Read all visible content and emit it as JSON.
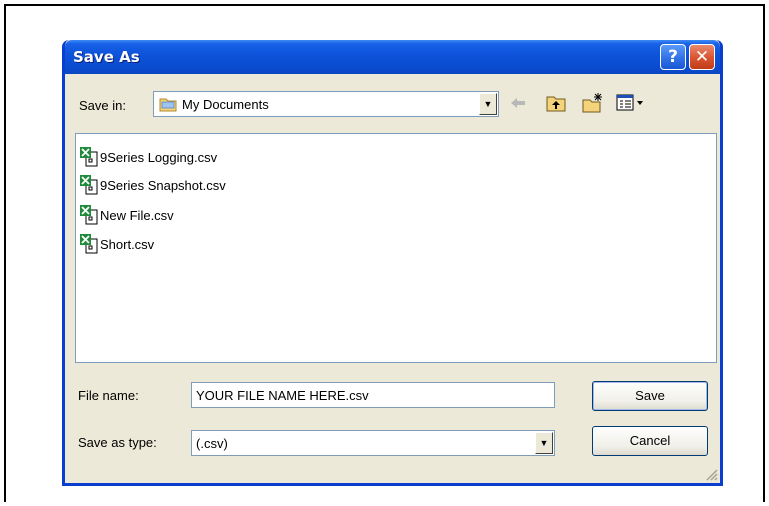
{
  "dialog": {
    "title": "Save As",
    "help_glyph": "?",
    "close_glyph": "✕"
  },
  "save_in": {
    "label": "Save in:",
    "value": "My Documents",
    "icon": "folder-icon"
  },
  "toolbar": {
    "back_icon": "back-arrow-icon",
    "up_icon": "up-folder-icon",
    "new_folder_icon": "new-folder-icon",
    "views_icon": "views-menu-icon"
  },
  "files": [
    {
      "name": "9Series Logging.csv",
      "icon": "excel-csv-icon"
    },
    {
      "name": "9Series Snapshot.csv",
      "icon": "excel-csv-icon"
    },
    {
      "name": "New File.csv",
      "icon": "excel-csv-icon"
    },
    {
      "name": "Short.csv",
      "icon": "excel-csv-icon"
    }
  ],
  "file_name": {
    "label": "File name:",
    "value": "YOUR FILE NAME HERE.csv"
  },
  "save_as_type": {
    "label": "Save as type:",
    "value": "(.csv)"
  },
  "buttons": {
    "save": "Save",
    "cancel": "Cancel"
  },
  "colors": {
    "titlebar": "#0a4cd0",
    "dialog_bg": "#ece9d8",
    "close_button": "#d9532e"
  }
}
